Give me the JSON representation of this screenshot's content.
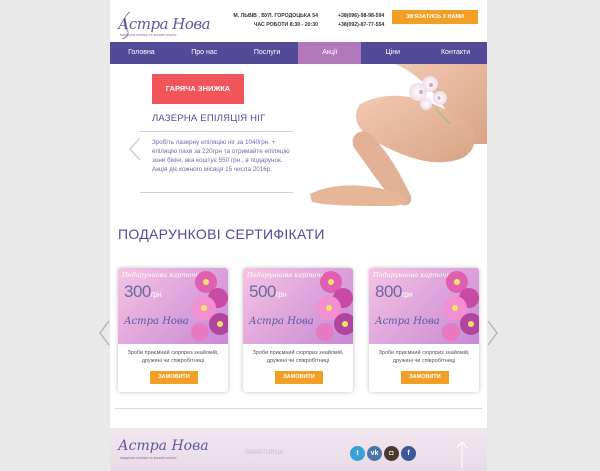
{
  "header": {
    "logo_text": "Астра Нова",
    "logo_sub": "медична клініка та косметологія",
    "address_line": "М. ЛЬВІВ , ВУЛ. ГОРОДОЦЬКА 54",
    "hours_line": "ЧАС РОБОТИ 8:30 - 20:30",
    "phone1": "+38(096)-98-98-594",
    "phone2": "+38(092)-87-77-554",
    "call_button": "ЗВ'ЯЗАТИСЬ З НАМИ"
  },
  "nav": {
    "items": [
      {
        "label": "Головна"
      },
      {
        "label": "Про нас"
      },
      {
        "label": "Послуги"
      },
      {
        "label": "Акції"
      },
      {
        "label": "Ціни"
      },
      {
        "label": "Контакти"
      }
    ],
    "active_index": 3
  },
  "promo": {
    "badge": "ГАРЯЧА ЗНИЖКА",
    "title": "ЛАЗЕРНА ЕПІЛЯЦІЯ НІГ",
    "text": "Зробіть лазерну епіляцію ніг за 1040грн. + епіляцію пахв за 220грн та отримайте епіляцію зони бікіні, яка коштує 550 грн., в подарунок. Акція діє кожного місяця 15 числа 2016р."
  },
  "certificates": {
    "title": "ПОДАРУНКОВІ СЕРТИФІКАТИ",
    "items": [
      {
        "card_label": "Подарункова карточка",
        "amount": "300",
        "unit": "грн",
        "logo": "Астра Нова",
        "desc": "Зроби приємний сюрприз знайомій, дружині чи співробітниці",
        "button": "ЗАМОВИТИ"
      },
      {
        "card_label": "Подарункова карточка",
        "amount": "500",
        "unit": "грн",
        "logo": "Астра Нова",
        "desc": "Зроби приємний сюрприз знайомій, дружині чи співробітниці",
        "button": "ЗАМОВИТИ"
      },
      {
        "card_label": "Подарункова карточка",
        "amount": "800",
        "unit": "грн",
        "logo": "Астра Нова",
        "desc": "Зроби приємний сюрприз знайомій, дружині чи співробітниці",
        "button": "ЗАМОВИТИ"
      }
    ]
  },
  "footer": {
    "logo_text": "Астра Нова",
    "logo_sub": "медична клініка та косметологія",
    "middle_text": "SMARTUP.UA",
    "socials": [
      {
        "icon": "twitter-icon",
        "glyph": "t"
      },
      {
        "icon": "vk-icon",
        "glyph": "vk"
      },
      {
        "icon": "instagram-icon",
        "glyph": "◘"
      },
      {
        "icon": "facebook-icon",
        "glyph": "f"
      }
    ]
  },
  "colors": {
    "brand_purple": "#534a98",
    "nav_active": "#b078b8",
    "accent_orange": "#f2a025",
    "hot_red": "#f0555a"
  }
}
